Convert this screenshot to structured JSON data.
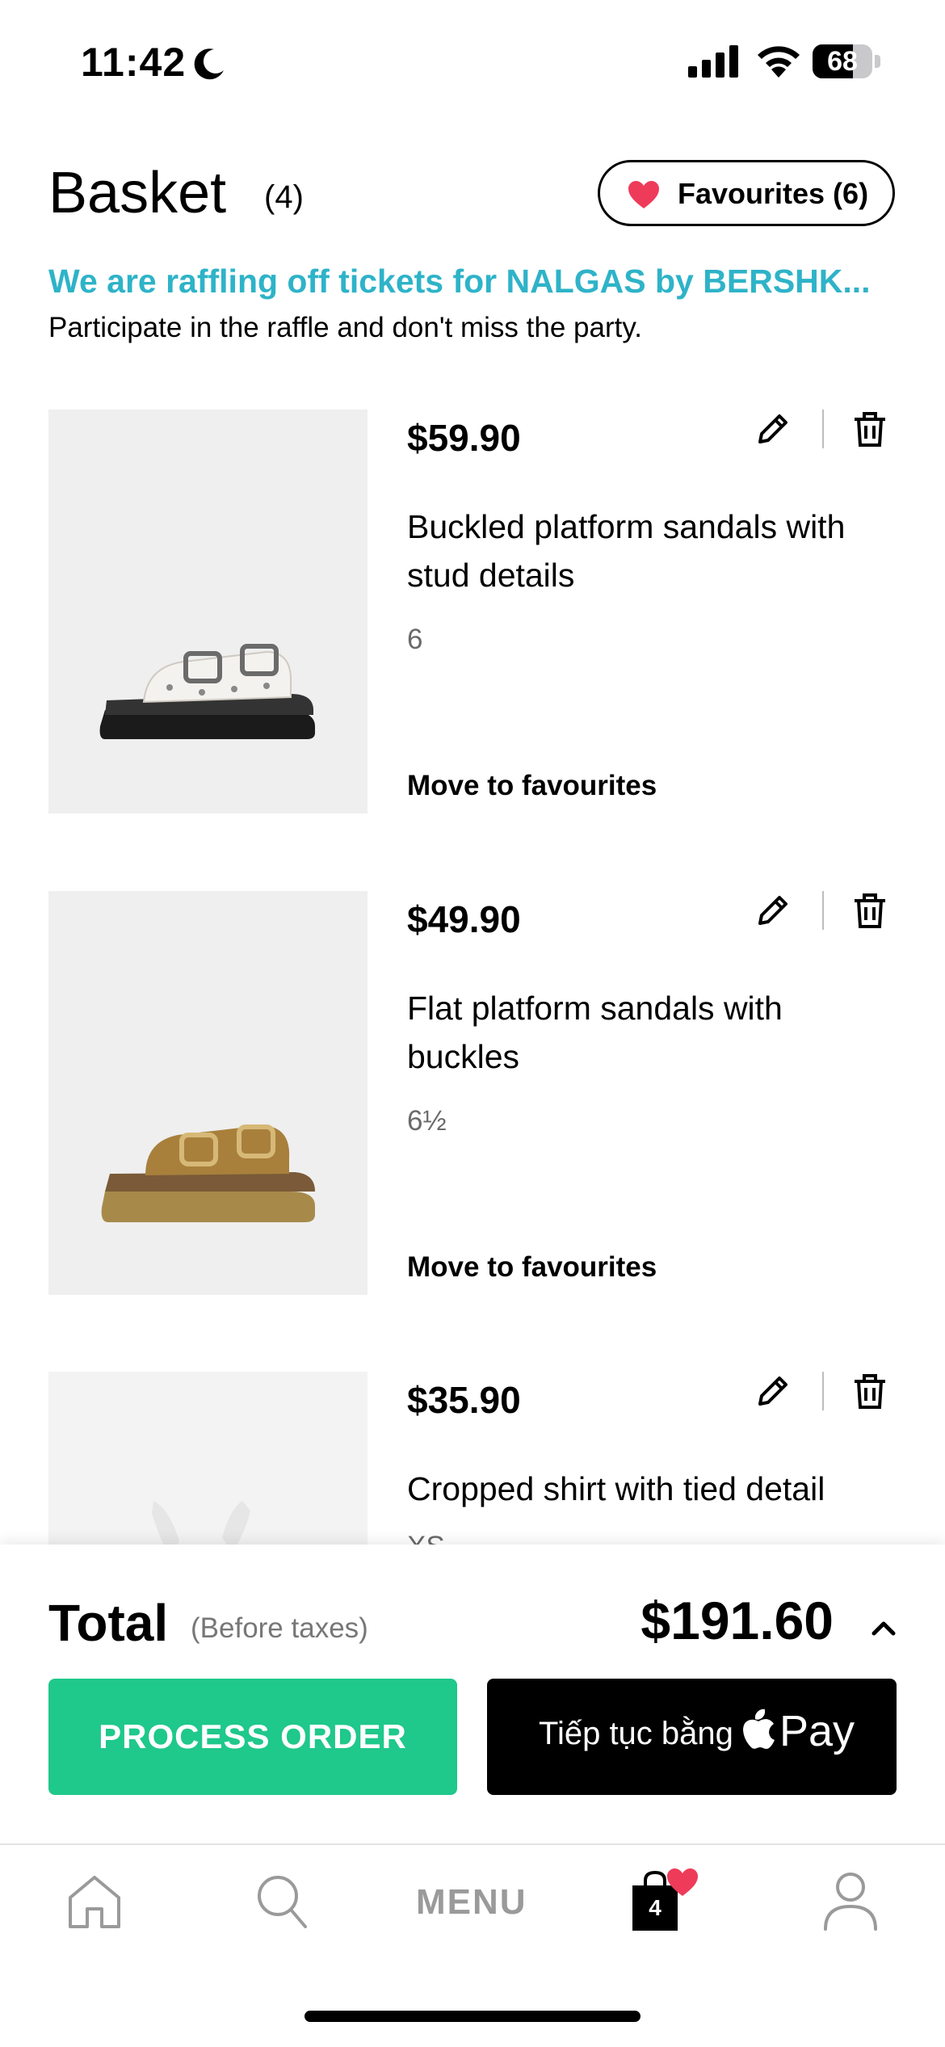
{
  "status_bar": {
    "time": "11:42",
    "battery_percent": "68",
    "battery_level": 0.68
  },
  "header": {
    "title": "Basket",
    "count": "(4)",
    "favourites_label": "Favourites (6)"
  },
  "promo": {
    "title": "We are raffling off tickets for NALGAS by BERSHK...",
    "text": "Participate in the raffle and don't miss the party."
  },
  "items": [
    {
      "price": "$59.90",
      "name": "Buckled platform sandals with stud details",
      "size": "6",
      "move_label": "Move to favourites"
    },
    {
      "price": "$49.90",
      "name": "Flat platform sandals with buckles",
      "size": "6½",
      "move_label": "Move to favourites"
    },
    {
      "price": "$35.90",
      "name": "Cropped shirt with tied detail",
      "size": "XS"
    }
  ],
  "summary": {
    "total_label": "Total",
    "taxes_note": "(Before taxes)",
    "total_value": "$191.60",
    "process_label": "PROCESS ORDER",
    "pay_prefix": "Tiếp tục bằng",
    "pay_word": "Pay"
  },
  "tab_bar": {
    "menu_label": "MENU",
    "bag_count": "4"
  },
  "colors": {
    "promo": "#2eb3c8",
    "process_button": "#1fc88b",
    "heart": "#ef3b5a",
    "text": "#000000"
  },
  "icons": [
    "moon-icon",
    "signal-icon",
    "wifi-icon",
    "heart-icon",
    "edit-icon",
    "delete-icon",
    "chevron-up-icon",
    "apple-icon",
    "home-icon",
    "search-icon",
    "bag-icon",
    "profile-icon"
  ]
}
